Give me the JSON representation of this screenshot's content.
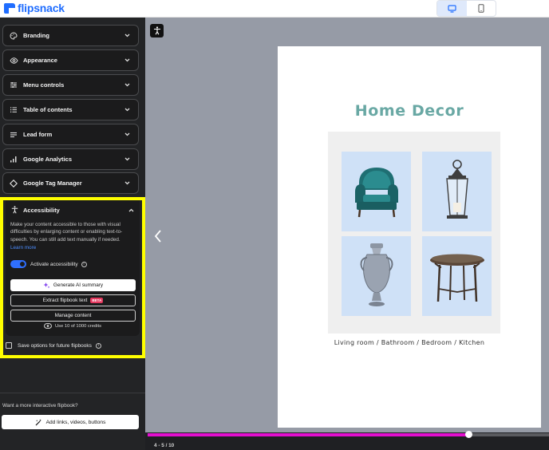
{
  "app": {
    "logo_text": "flipsnack",
    "brand_color": "#1f6dff"
  },
  "device_toggle": {
    "options": [
      "desktop-icon",
      "mobile-icon"
    ],
    "selected": "desktop"
  },
  "sidebar": {
    "sections": [
      {
        "label": "Branding",
        "icon": "palette-icon"
      },
      {
        "label": "Appearance",
        "icon": "eye-icon"
      },
      {
        "label": "Menu controls",
        "icon": "sliders-icon"
      },
      {
        "label": "Table of contents",
        "icon": "list-icon"
      },
      {
        "label": "Lead form",
        "icon": "form-lines-icon"
      },
      {
        "label": "Google Analytics",
        "icon": "bar-chart-icon"
      },
      {
        "label": "Google Tag Manager",
        "icon": "diamond-icon"
      }
    ],
    "accessibility": {
      "title": "Accessibility",
      "highlight_color": "#ffff00",
      "description": "Make your content accessible to those with visual difficulties by enlarging content or enabling text-to-speech. You can still add text manually if needed.",
      "learn_more": "Learn more",
      "toggle_label": "Activate accessibility",
      "toggle_on": true,
      "generate_ai_label": "Generate AI summary",
      "extract_label": "Extract flipbook text",
      "beta_badge": "BETA",
      "manage_label": "Manage content",
      "credits_text": "Use 10 of 1000 credits",
      "save_options_label": "Save options for future flipbooks"
    },
    "interactive_prompt": "Want a more interactive flipbook?",
    "add_button_label": "Add links, videos, buttons"
  },
  "preview": {
    "page_title": "Home Decor",
    "caption": "Living room / Bathroom / Bedroom / Kitchen",
    "title_color": "#69a8a4"
  },
  "progress": {
    "fraction": 0.8,
    "bar_color": "#e30fcf",
    "page_indicator": "4 - 5 / 10"
  }
}
